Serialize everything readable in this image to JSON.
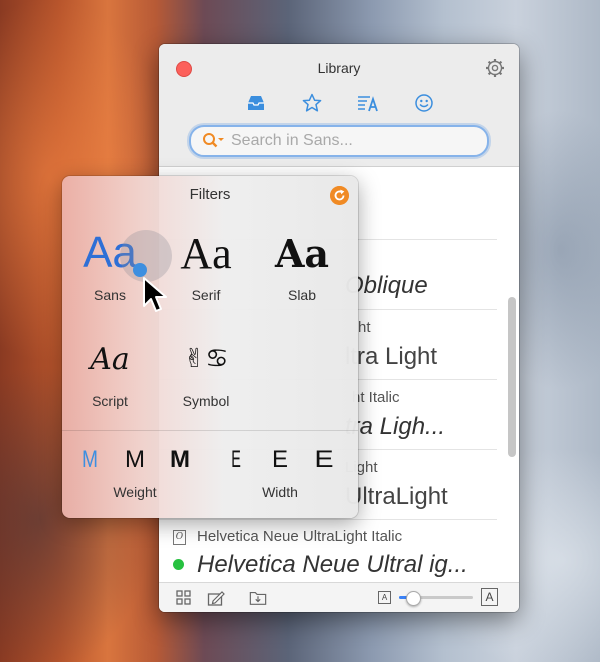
{
  "window": {
    "title": "Library",
    "tabs": [
      {
        "icon": "inbox-tray-icon"
      },
      {
        "icon": "star-icon"
      },
      {
        "icon": "text-list-icon"
      },
      {
        "icon": "smiley-icon"
      }
    ],
    "search_placeholder": "Search in Sans...",
    "accent_color": "#86b3ea"
  },
  "list": {
    "rows": [
      {
        "name": "",
        "sample": ""
      },
      {
        "name": "",
        "sample": "Oblique"
      },
      {
        "name": "ht",
        "sample": "ltra Light"
      },
      {
        "name": "ht Italic",
        "sample": "tra Ligh..."
      },
      {
        "name": "Light",
        "sample": "UltraLight"
      },
      {
        "name": "Helvetica Neue UltraLight Italic",
        "sample": "Helvetica Neue Ultral ig..."
      }
    ]
  },
  "popover": {
    "title": "Filters",
    "reset_color": "#f08a24",
    "categories": [
      {
        "glyph": "Aa",
        "label": "Sans",
        "selected": true
      },
      {
        "glyph": "Aa",
        "label": "Serif"
      },
      {
        "glyph": "Aa",
        "label": "Slab"
      },
      {
        "glyph": "Aa",
        "label": "Script"
      },
      {
        "glyph": "✌♋",
        "label": "Symbol"
      }
    ],
    "weight": {
      "label": "Weight",
      "glyphs": [
        "M",
        "M",
        "M"
      ],
      "selected_index": 0
    },
    "width": {
      "label": "Width",
      "glyphs": [
        "E",
        "E",
        "E"
      ]
    }
  },
  "bottombar": {
    "size_small": "A",
    "size_large": "A",
    "size_slider_value": 0.12
  }
}
